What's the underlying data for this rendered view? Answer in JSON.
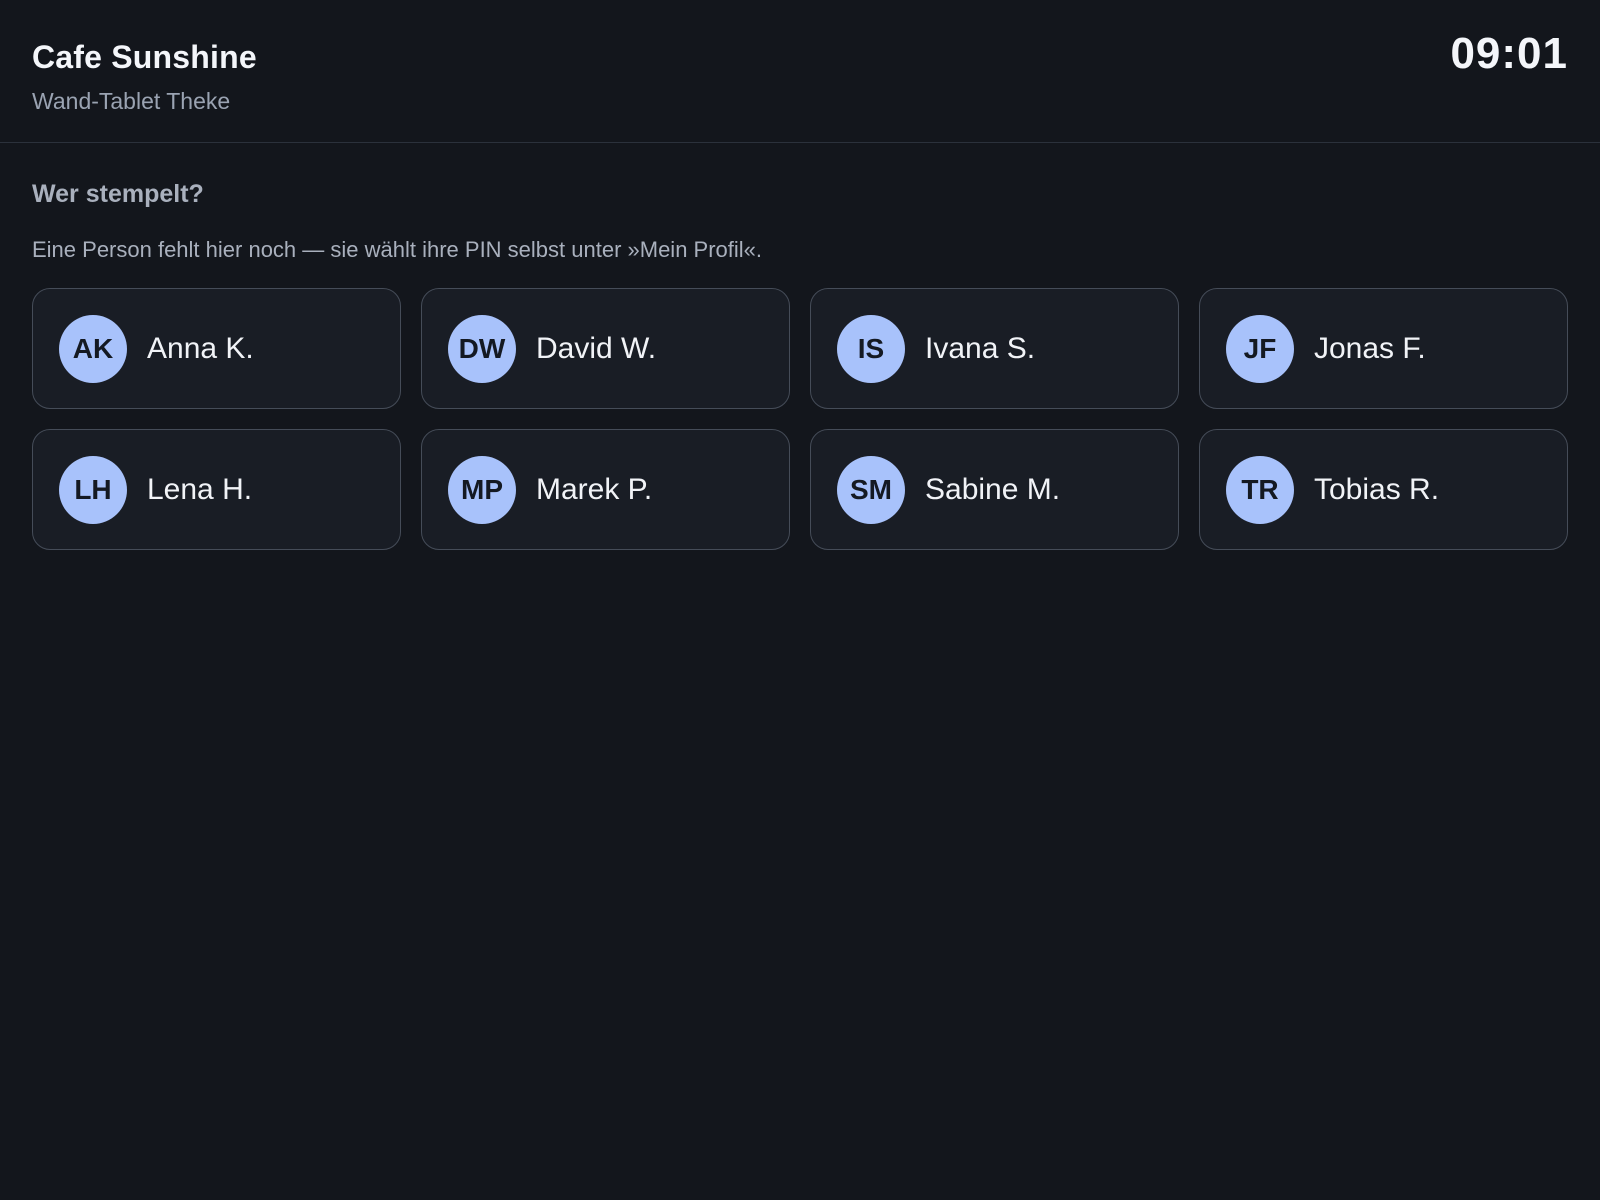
{
  "header": {
    "cafe_name": "Cafe Sunshine",
    "device_name": "Wand-Tablet Theke",
    "time": "09:01"
  },
  "main": {
    "question": "Wer stempelt?",
    "hint": "Eine Person fehlt hier noch — sie wählt ihre PIN selbst unter »Mein Profil«.",
    "employees": [
      {
        "initials": "AK",
        "name": "Anna K."
      },
      {
        "initials": "DW",
        "name": "David W."
      },
      {
        "initials": "IS",
        "name": "Ivana S."
      },
      {
        "initials": "JF",
        "name": "Jonas F."
      },
      {
        "initials": "LH",
        "name": "Lena H."
      },
      {
        "initials": "MP",
        "name": "Marek P."
      },
      {
        "initials": "SM",
        "name": "Sabine M."
      },
      {
        "initials": "TR",
        "name": "Tobias R."
      }
    ]
  },
  "colors": {
    "background": "#13161c",
    "card_background": "#191d25",
    "card_border": "#454c58",
    "avatar": "#a8c2fb",
    "muted_text": "#a9b0bd"
  }
}
